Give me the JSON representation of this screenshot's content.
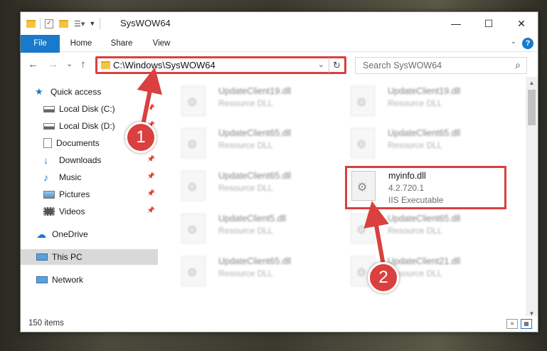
{
  "window": {
    "title": "SysWOW64"
  },
  "ribbon": {
    "tabs": [
      "File",
      "Home",
      "Share",
      "View"
    ],
    "help_label": "?"
  },
  "nav": {
    "back": "←",
    "forward": "→",
    "recent": "⌄",
    "up": "↑",
    "address": "C:\\Windows\\SysWOW64",
    "address_dropdown": "⌄",
    "refresh": "↻",
    "search_placeholder": "Search SysWOW64",
    "search_icon": "⌕"
  },
  "sidebar": {
    "items": [
      {
        "label": "Quick access",
        "icon": "star-icon"
      },
      {
        "label": "Local Disk (C:)",
        "icon": "drive-icon",
        "pinned": true
      },
      {
        "label": "Local Disk (D:)",
        "icon": "drive-icon",
        "pinned": true
      },
      {
        "label": "Documents",
        "icon": "documents-icon",
        "pinned": true
      },
      {
        "label": "Downloads",
        "icon": "download-icon",
        "pinned": true
      },
      {
        "label": "Music",
        "icon": "music-icon",
        "pinned": true
      },
      {
        "label": "Pictures",
        "icon": "pictures-icon",
        "pinned": true
      },
      {
        "label": "Videos",
        "icon": "videos-icon",
        "pinned": true
      },
      {
        "label": "OneDrive",
        "icon": "cloud-icon"
      },
      {
        "label": "This PC",
        "icon": "computer-icon",
        "selected": true
      },
      {
        "label": "Network",
        "icon": "network-icon"
      }
    ]
  },
  "files": [
    {
      "name": "UpdateClient19.dll",
      "line2": "Resource DLL",
      "line3": ""
    },
    {
      "name": "UpdateClient19.dll",
      "line2": "Resource DLL",
      "line3": ""
    },
    {
      "name": "UpdateClient65.dll",
      "line2": "Resource DLL",
      "line3": ""
    },
    {
      "name": "UpdateClient65.dll",
      "line2": "Resource DLL",
      "line3": ""
    },
    {
      "name": "UpdateClient65.dll",
      "line2": "Resource DLL",
      "line3": ""
    },
    {
      "name": "myinfo.dll",
      "line2": "4.2.720.1",
      "line3": "IIS Executable"
    },
    {
      "name": "UpdateClient5.dll",
      "line2": "Resource DLL",
      "line3": ""
    },
    {
      "name": "UpdateClient65.dll",
      "line2": "Resource DLL",
      "line3": ""
    },
    {
      "name": "UpdateClient65.dll",
      "line2": "Resource DLL",
      "line3": ""
    },
    {
      "name": "UpdateClient21.dll",
      "line2": "Resource DLL",
      "line3": ""
    }
  ],
  "status": {
    "item_count": "150 items"
  },
  "callouts": [
    "1",
    "2"
  ],
  "colors": {
    "accent": "#1979ca",
    "highlight": "#d9403f"
  }
}
